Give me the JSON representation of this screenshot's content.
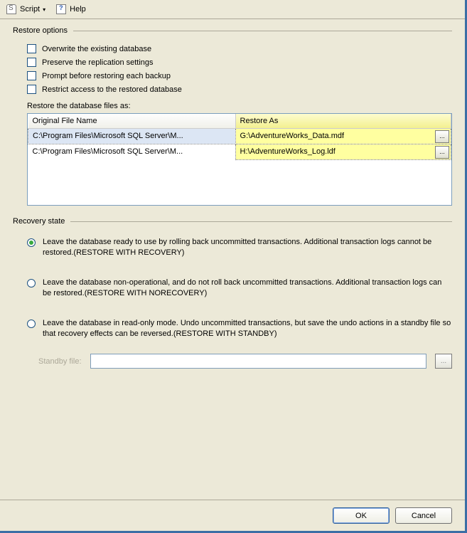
{
  "toolbar": {
    "script_label": "Script",
    "help_label": "Help"
  },
  "restore_options": {
    "legend": "Restore options",
    "overwrite": "Overwrite the existing database",
    "preserve": "Preserve the replication settings",
    "prompt": "Prompt before restoring each backup",
    "restrict": "Restrict access to the restored database",
    "files_label": "Restore the database files as:",
    "col_original": "Original File Name",
    "col_restore_as": "Restore As",
    "rows": [
      {
        "original": "C:\\Program Files\\Microsoft SQL Server\\M...",
        "restore_as": "G:\\AdventureWorks_Data.mdf"
      },
      {
        "original": "C:\\Program Files\\Microsoft SQL Server\\M...",
        "restore_as": "H:\\AdventureWorks_Log.ldf"
      }
    ]
  },
  "recovery_state": {
    "legend": "Recovery state",
    "opt1": "Leave the database ready to use by rolling back uncommitted transactions. Additional transaction logs cannot be restored.(RESTORE WITH RECOVERY)",
    "opt2": "Leave the database non-operational, and do not roll back uncommitted transactions. Additional transaction logs can be restored.(RESTORE WITH NORECOVERY)",
    "opt3": "Leave the database in read-only mode. Undo uncommitted transactions, but save the undo actions in a standby file so that recovery effects can be reversed.(RESTORE WITH STANDBY)",
    "standby_label": "Standby file:"
  },
  "buttons": {
    "ok": "OK",
    "cancel": "Cancel",
    "browse": "..."
  }
}
